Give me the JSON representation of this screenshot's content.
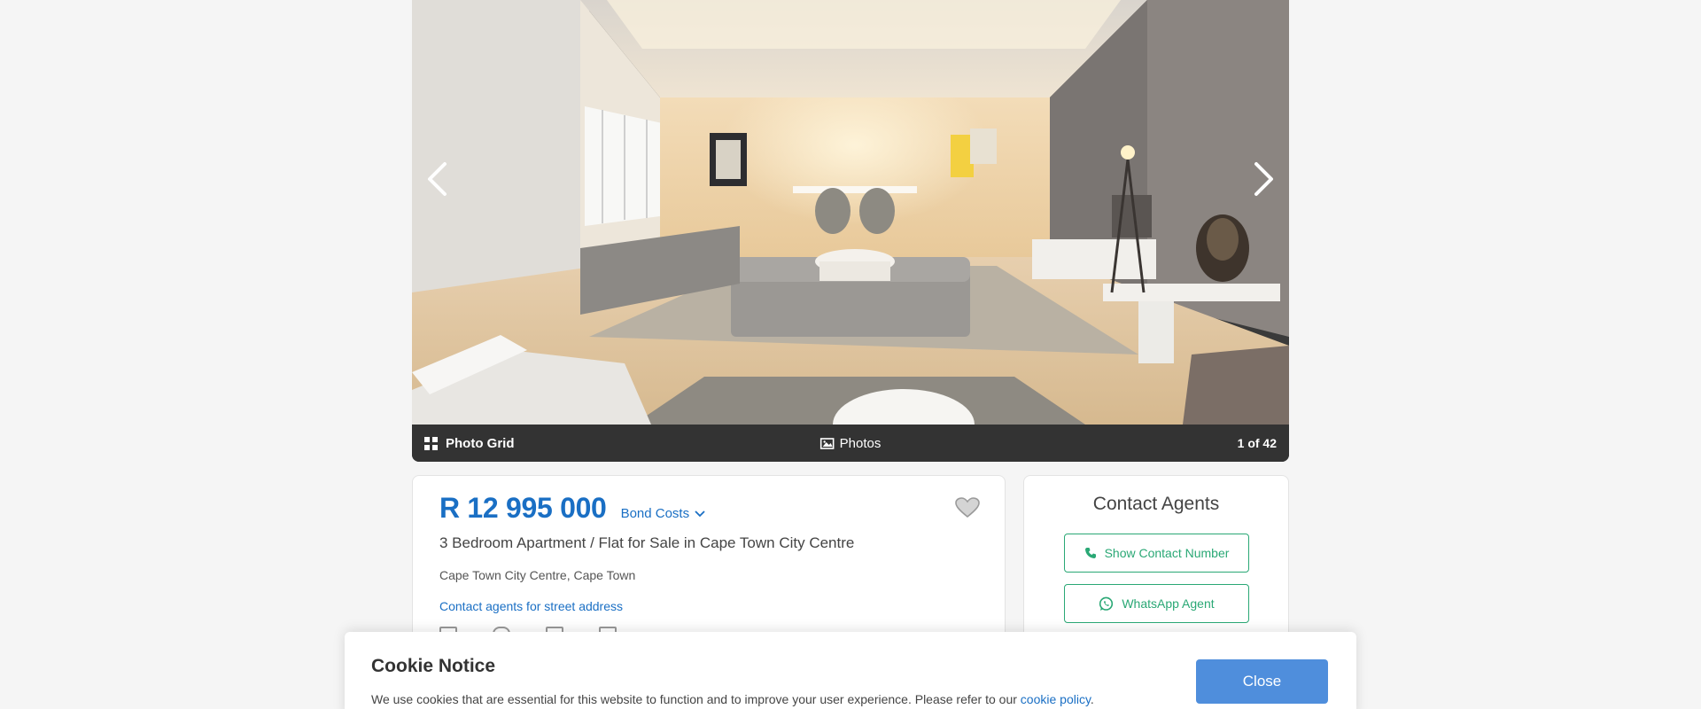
{
  "gallery": {
    "photo_alt": "Living room",
    "photo_grid_label": "Photo Grid",
    "photos_label": "Photos",
    "counter": "1 of 42"
  },
  "listing": {
    "price": "R 12 995 000",
    "bond_costs_label": "Bond Costs",
    "title": "3 Bedroom Apartment / Flat for Sale in Cape Town City Centre",
    "location": "Cape Town City Centre, Cape Town",
    "street_link": "Contact agents for street address"
  },
  "contact": {
    "title": "Contact Agents",
    "show_number_label": "Show Contact Number",
    "whatsapp_label": "WhatsApp Agent"
  },
  "cookie": {
    "title": "Cookie Notice",
    "text": "We use cookies that are essential for this website to function and to improve your user experience. Please refer to our ",
    "link_text": "cookie policy",
    "text_end": ".",
    "close_label": "Close"
  },
  "colors": {
    "brand_blue": "#1a6fc4",
    "whatsapp_green": "#2aa875",
    "close_button": "#4f8edc",
    "gallery_bar": "#333333"
  },
  "icons": {
    "prev": "chevron-left-icon",
    "next": "chevron-right-icon",
    "grid": "grid-icon",
    "photos": "image-icon",
    "favourite": "heart-icon",
    "bond": "chevron-down-icon",
    "phone": "phone-icon",
    "whatsapp": "whatsapp-icon"
  }
}
